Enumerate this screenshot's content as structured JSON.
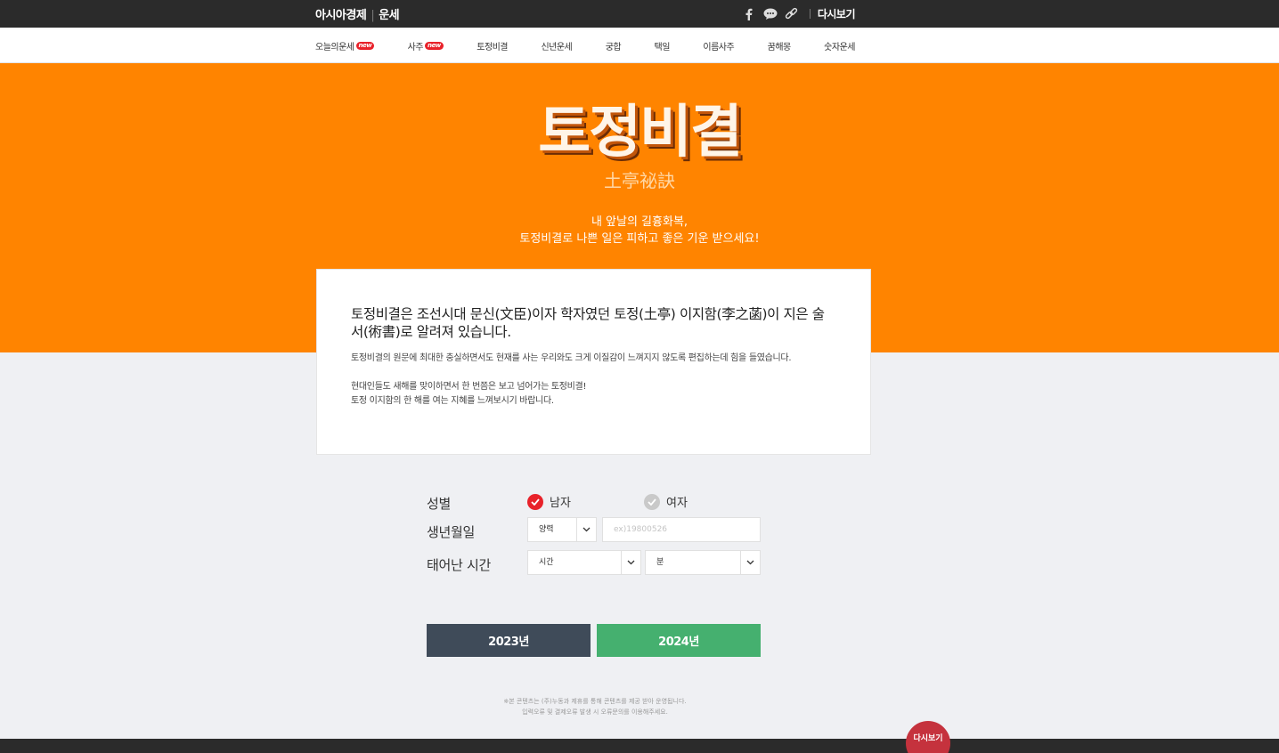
{
  "header": {
    "brand": "아시아경제",
    "section": "운세",
    "replay_label": "다시보기",
    "icons": [
      "facebook-icon",
      "chat-icon",
      "link-icon"
    ]
  },
  "nav": {
    "items": [
      {
        "label": "오늘의운세",
        "badge": "new"
      },
      {
        "label": "사주",
        "badge": "new"
      },
      {
        "label": "토정비결",
        "badge": ""
      },
      {
        "label": "신년운세",
        "badge": ""
      },
      {
        "label": "궁합",
        "badge": ""
      },
      {
        "label": "택일",
        "badge": ""
      },
      {
        "label": "이름사주",
        "badge": ""
      },
      {
        "label": "꿈해몽",
        "badge": ""
      },
      {
        "label": "숫자운세",
        "badge": ""
      }
    ]
  },
  "hero": {
    "title": "토정비결",
    "hanja": "土亭祕訣",
    "desc_line1": "내 앞날의 길흉화복,",
    "desc_line2": "토정비결로 나쁜 일은 피하고 좋은 기운 받으세요!",
    "bg_color": "#ff8400"
  },
  "card": {
    "lead": "토정비결은 조선시대 문신(文臣)이자 학자였던 토정(土亭) 이지함(李之菡)이 지은 술서(術書)로 알려져 있습니다.",
    "para1": "토정비결의 원문에 최대한 충실하면서도 현재를 사는 우리와도 크게 이질감이 느껴지지 않도록 편집하는데 힘을 들였습니다.",
    "para2_line1": "현대인들도 새해를 맞이하면서 한 번쯤은 보고 넘어가는 토정비결!",
    "para2_line2": "토정 이지함의 한 해를 여는 지혜를 느껴보시기 바랍니다."
  },
  "form": {
    "gender_label": "성별",
    "male_label": "남자",
    "female_label": "여자",
    "birth_label": "생년월일",
    "calendar_value": "양력",
    "birth_placeholder": "ex)19800526",
    "time_label": "태어난 시간",
    "hour_value": "시간",
    "minute_value": "분"
  },
  "buttons": {
    "year1": "2023년",
    "year2": "2024년"
  },
  "footnote": {
    "line1": "※본 콘텐츠는 (주)누동과 제휴를 통해 콘텐츠를 제공 받아 운영됩니다.",
    "line2": "입력오류 및 결제오류 발생 시 오류문의를 이용해주세요."
  },
  "floating": {
    "label": "다시보기"
  },
  "colors": {
    "accent": "#ff8400",
    "male_selected": "#e8222a",
    "btn_2023": "#3f4b59",
    "btn_2024": "#45b06f"
  }
}
